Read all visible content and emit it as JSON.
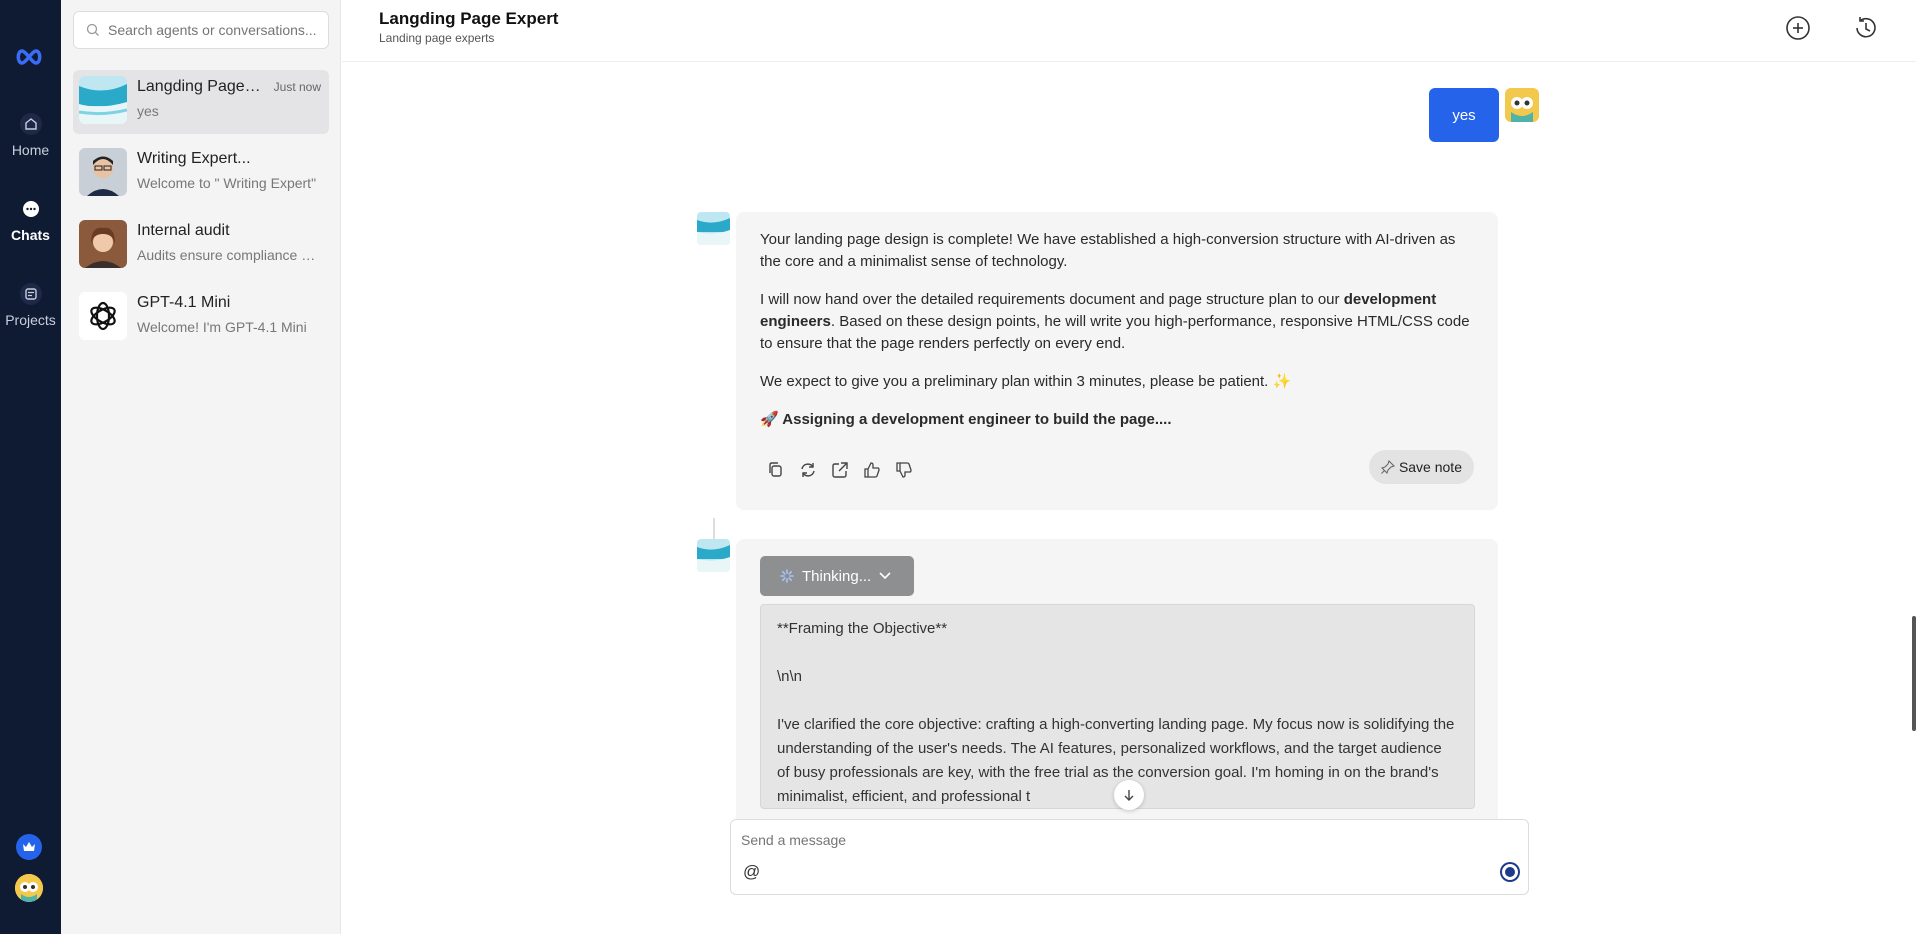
{
  "rail": {
    "items": [
      {
        "label": "Home",
        "icon": "home-icon"
      },
      {
        "label": "Chats",
        "icon": "chat-icon"
      },
      {
        "label": "Projects",
        "icon": "projects-icon"
      }
    ]
  },
  "sidebar": {
    "search_placeholder": "Search agents or conversations...",
    "conversations": [
      {
        "name": "Langding Page Expert",
        "time": "Just now",
        "preview": "yes"
      },
      {
        "name": "Writing Expert...",
        "time": "",
        "preview": "Welcome to \" Writing Expert\""
      },
      {
        "name": "Internal audit",
        "time": "",
        "preview": "Audits ensure compliance with"
      },
      {
        "name": "GPT-4.1 Mini",
        "time": "",
        "preview": "Welcome! I'm GPT-4.1 Mini"
      }
    ]
  },
  "header": {
    "title": "Langding Page Expert",
    "subtitle": "Landing page experts"
  },
  "chat": {
    "user_message": "yes",
    "bot_message": {
      "p1": "Your landing page design is complete! We have established a high-conversion structure with AI-driven as the core and a minimalist sense of technology.",
      "p2_before": "I will now hand over the detailed requirements document and page structure plan to our ",
      "p2_bold": "development engineers",
      "p2_after": ". Based on these design points, he will write you high-performance, responsive HTML/CSS code to ensure that the page renders perfectly on every end.",
      "p3": "We expect to give you a preliminary plan within 3 minutes, please be patient. ✨",
      "p4": "🚀 Assigning a development engineer to build the page....",
      "save_note": "Save note"
    },
    "thinking": {
      "label": "Thinking...",
      "line1": "**Framing the Objective**",
      "line2": "\\n\\n",
      "line3": "I've clarified the core objective: crafting a high-converting landing page. My focus now is solidifying the understanding of the user's needs. The AI features, personalized workflows, and the target audience of busy professionals are key, with the free trial as the conversion goal. I'm homing in on the brand's minimalist, efficient, and professional t"
    }
  },
  "composer": {
    "placeholder": "Send a message",
    "mention": "@"
  },
  "colors": {
    "rail_bg": "#0f1a33",
    "accent": "#2563eb",
    "bubble_bg": "#f5f5f6"
  }
}
